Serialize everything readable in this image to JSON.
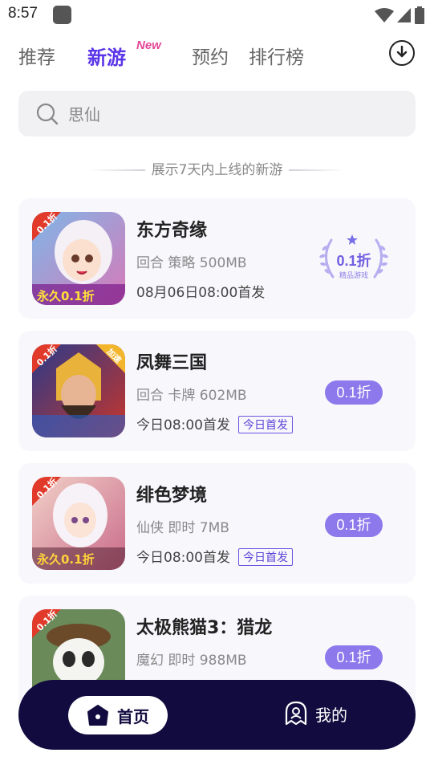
{
  "status_bar": {
    "time": "8:57"
  },
  "top_tabs": {
    "recommend": "推荐",
    "new_games": "新游",
    "new_badge": "New",
    "reserve": "预约",
    "ranking": "排行榜"
  },
  "search": {
    "value": "思仙"
  },
  "section_note": "展示7天内上线的新游",
  "games": [
    {
      "name": "东方奇缘",
      "meta": "回合 策略 500MB",
      "date": "08月06日08:00首发",
      "tag": "",
      "discount": "0.1折",
      "discount_sub": "精品游戏",
      "thumb_badge": "0.1折",
      "thumb_caption": "永久0.1折"
    },
    {
      "name": "凤舞三国",
      "meta": "回合 卡牌 602MB",
      "date": "今日08:00首发",
      "tag": "今日首发",
      "discount": "0.1折",
      "thumb_badge": "0.1折",
      "thumb_corner": "加速"
    },
    {
      "name": "绯色梦境",
      "meta": "仙侠 即时 7MB",
      "date": "今日08:00首发",
      "tag": "今日首发",
      "discount": "0.1折",
      "thumb_badge": "0.1折",
      "thumb_caption": "永久0.1折"
    },
    {
      "name": "太极熊猫3：猎龙",
      "meta": "魔幻 即时 988MB",
      "discount": "0.1折",
      "thumb_badge": "0.1折"
    }
  ],
  "bottom_nav": {
    "home": "首页",
    "mine": "我的"
  },
  "colors": {
    "accent": "#5b35e8",
    "discount_pill": "#8d79ec",
    "bottom_bar": "#120b3f"
  }
}
